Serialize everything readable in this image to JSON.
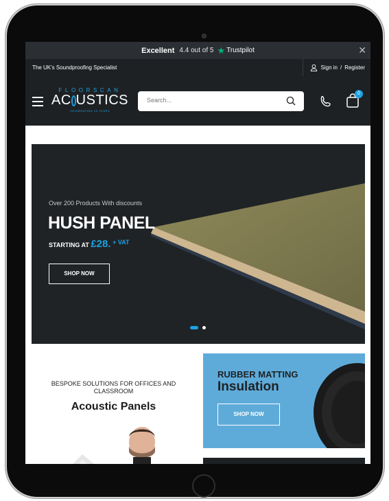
{
  "trustpilot": {
    "rating_word": "Excellent",
    "rating_text": "4.4 out of 5",
    "brand": "Trustpilot",
    "close_icon": "close-icon"
  },
  "topbar": {
    "tagline": "The UK's Soundproofing Specialist",
    "sign_in": "Sign in",
    "separator": "/",
    "register": "Register"
  },
  "header": {
    "logo_top": "FLOORSCAN",
    "logo_main_a": "AC",
    "logo_main_b": "USTICS",
    "logo_sub": "CELEBRATING 25 YEARS",
    "search_placeholder": "Search...",
    "cart_count": "0"
  },
  "hero": {
    "pretitle": "Over 200 Products With discounts",
    "title": "HUSH PANEL",
    "starting_at": "STARTING AT",
    "price": "£28.",
    "vat": "+ VAT",
    "cta": "SHOP NOW"
  },
  "promo_left": {
    "kicker": "BESPOKE SOLUTIONS FOR OFFICES AND CLASSROOM",
    "heading": "Acoustic Panels"
  },
  "promo_right": {
    "line1": "RUBBER MATTING",
    "line2": "Insulation",
    "cta": "SHOP NOW"
  },
  "colors": {
    "accent": "#1da1e2",
    "dark": "#1e2124",
    "trustpilot_green": "#00b67a",
    "promo_blue": "#5eabd9"
  }
}
